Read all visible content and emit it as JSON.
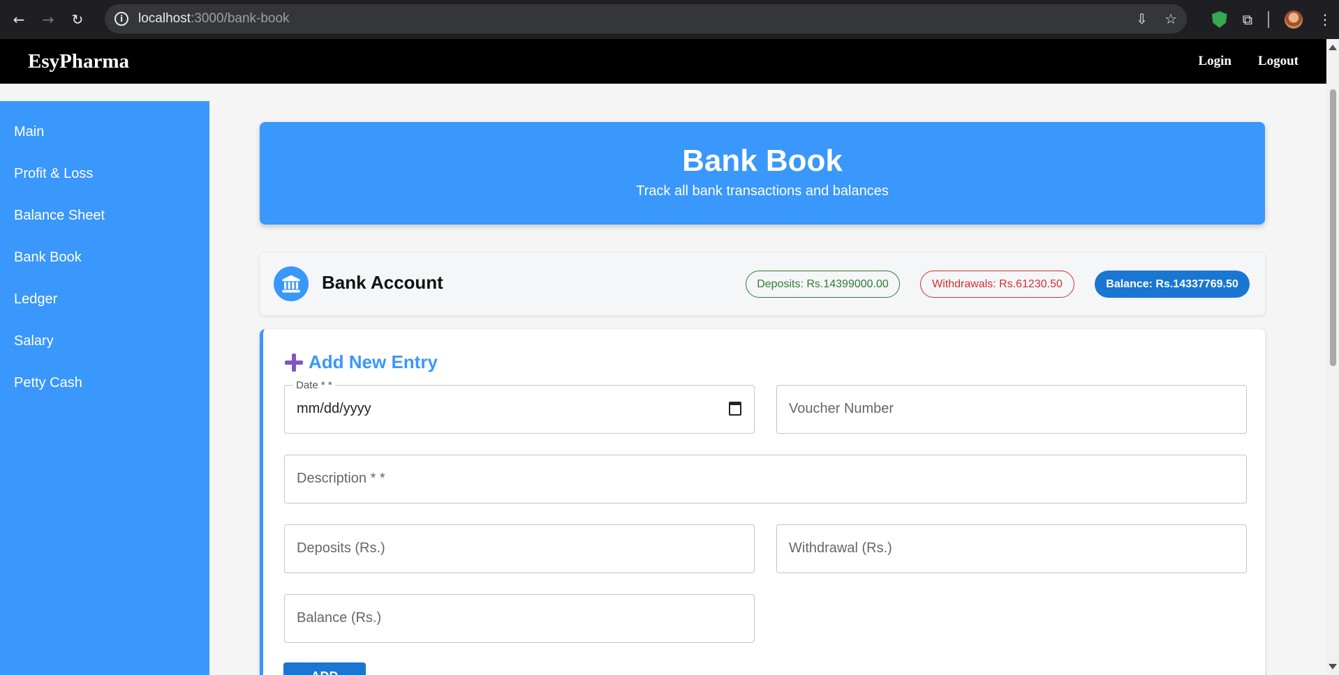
{
  "browser": {
    "url_host": "localhost",
    "url_path": ":3000/bank-book"
  },
  "navbar": {
    "brand": "EsyPharma",
    "login": "Login",
    "logout": "Logout"
  },
  "sidebar": {
    "items": [
      {
        "label": "Main"
      },
      {
        "label": "Profit & Loss"
      },
      {
        "label": "Balance Sheet"
      },
      {
        "label": "Bank Book"
      },
      {
        "label": "Ledger"
      },
      {
        "label": "Salary"
      },
      {
        "label": "Petty Cash"
      }
    ]
  },
  "hero": {
    "title": "Bank Book",
    "subtitle": "Track all bank transactions and balances"
  },
  "account": {
    "title": "Bank Account",
    "deposits": "Deposits: Rs.14399000.00",
    "withdrawals": "Withdrawals: Rs.61230.50",
    "balance": "Balance: Rs.14337769.50"
  },
  "form": {
    "title": "Add New Entry",
    "date_label": "Date * *",
    "date_value": "mm/dd/yyyy",
    "voucher_placeholder": "Voucher Number",
    "description_placeholder": "Description * *",
    "deposits_placeholder": "Deposits (Rs.)",
    "withdrawal_placeholder": "Withdrawal (Rs.)",
    "balance_placeholder": "Balance (Rs.)",
    "submit_label": "ADD"
  },
  "colors": {
    "primary": "#3a97fb",
    "dark_primary": "#1976d2",
    "deposit_green": "#2e7d32",
    "withdrawal_red": "#d32f2f",
    "navbar_bg": "#000000"
  }
}
